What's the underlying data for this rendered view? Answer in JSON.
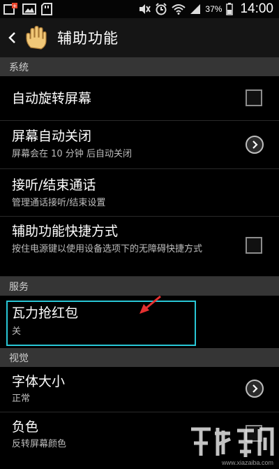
{
  "status_bar": {
    "battery_percent": "37%",
    "time": "14:00"
  },
  "action_bar": {
    "title": "辅助功能"
  },
  "sections": {
    "system": "系统",
    "services": "服务",
    "vision": "视觉"
  },
  "rows": {
    "auto_rotate": {
      "title": "自动旋转屏幕",
      "checked": false
    },
    "screen_timeout": {
      "title": "屏幕自动关闭",
      "subtitle": "屏幕会在 10 分钟 后自动关闭"
    },
    "answer_end_calls": {
      "title": "接听/结束通话",
      "subtitle": "管理通话接听/结束设置"
    },
    "accessibility_shortcut": {
      "title": "辅助功能快捷方式",
      "subtitle": "按住电源键以使用设备选项下的无障碍快捷方式",
      "checked": false
    },
    "wali_red_packet": {
      "title": "瓦力抢红包",
      "subtitle": "关"
    },
    "font_size": {
      "title": "字体大小",
      "subtitle": "正常"
    },
    "negative_colors": {
      "title": "负色",
      "subtitle": "反转屏幕颜色",
      "checked": false
    }
  },
  "colors": {
    "highlight": "#29c7d6",
    "annotation_arrow": "#e53030"
  },
  "watermark": {
    "small_text": "www.xiazaiba.com"
  }
}
